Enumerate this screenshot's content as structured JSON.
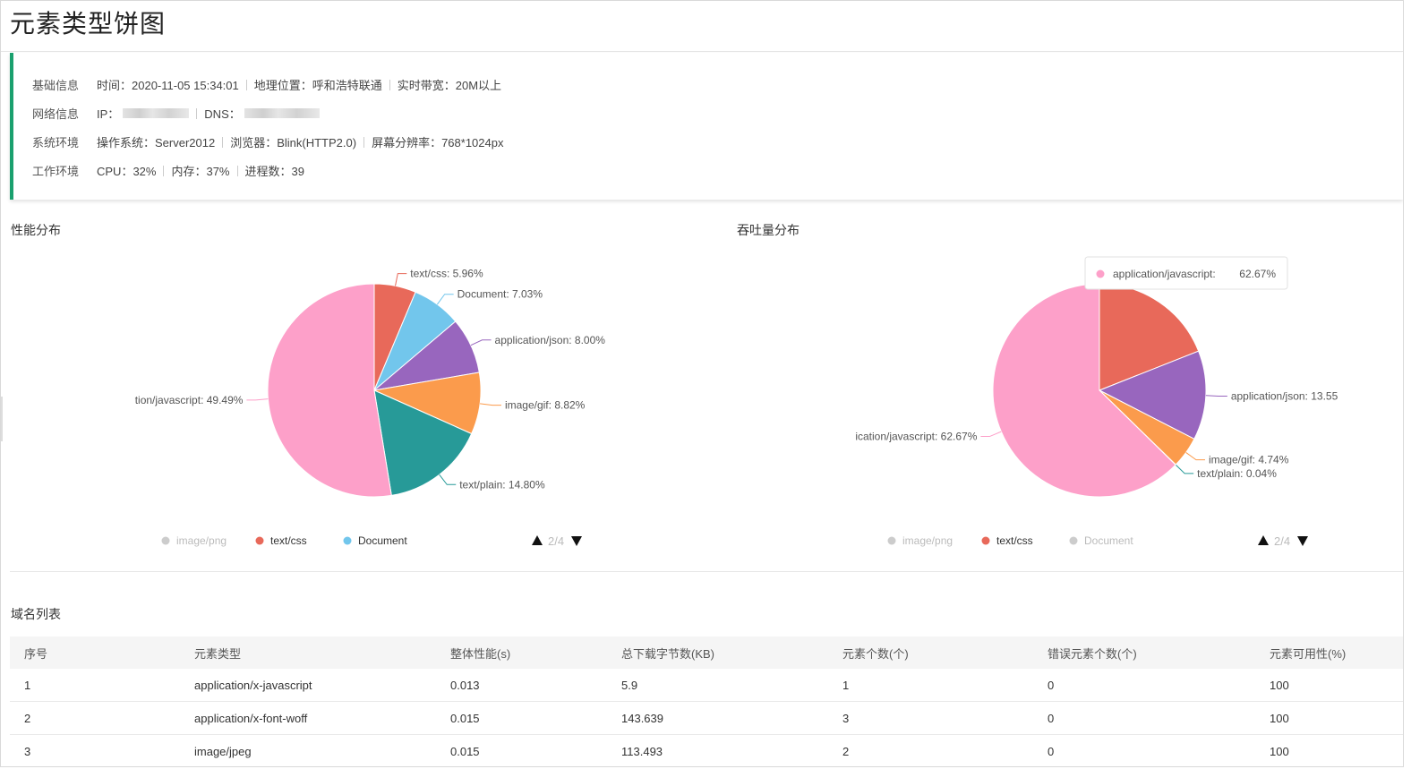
{
  "page": {
    "title": "元素类型饼图"
  },
  "info": {
    "rows": [
      {
        "label": "基础信息",
        "items": [
          "时间：2020-11-05 15:34:01",
          "地理位置：呼和浩特联通",
          "实时带宽：20M以上"
        ]
      },
      {
        "label": "网络信息",
        "ip_label": "IP：",
        "dns_label": "DNS："
      },
      {
        "label": "系统环境",
        "items": [
          "操作系统：Server2012",
          "浏览器：Blink(HTTP2.0)",
          "屏幕分辨率：768*1024px"
        ]
      },
      {
        "label": "工作环境",
        "items": [
          "CPU：32%",
          "内存：37%",
          "进程数：39"
        ]
      }
    ]
  },
  "charts": {
    "left_title": "性能分布",
    "right_title": "吞吐量分布",
    "pager_text": "2/4",
    "tooltip": {
      "name": "application/javascript:",
      "value": "62.67%"
    }
  },
  "chart_data": [
    {
      "type": "pie",
      "title": "性能分布",
      "slices": [
        {
          "name": "text/css",
          "value": 5.96,
          "color": "#e8695a",
          "label": "text/css: 5.96%"
        },
        {
          "name": "Document",
          "value": 7.03,
          "color": "#72c6ec",
          "label": "Document: 7.03%"
        },
        {
          "name": "application/json",
          "value": 8.0,
          "color": "#9866be",
          "label": "application/json: 8.00%"
        },
        {
          "name": "image/gif",
          "value": 8.82,
          "color": "#fb9b4c",
          "label": "image/gif: 8.82%"
        },
        {
          "name": "text/plain",
          "value": 14.8,
          "color": "#279a98",
          "label": "text/plain: 14.80%"
        },
        {
          "name": "application/javascript",
          "value": 49.49,
          "color": "#fda0c9",
          "label": "tion/javascript: 49.49%"
        }
      ],
      "legend": [
        {
          "name": "image/png",
          "color": "#cccccc",
          "active": false
        },
        {
          "name": "text/css",
          "color": "#e8695a",
          "active": true
        },
        {
          "name": "Document",
          "color": "#72c6ec",
          "active": true
        }
      ]
    },
    {
      "type": "pie",
      "title": "吞吐量分布",
      "slices": [
        {
          "name": "text/css",
          "value": 19.0,
          "color": "#e8695a",
          "label": ""
        },
        {
          "name": "application/json",
          "value": 13.55,
          "color": "#9866be",
          "label": "application/json: 13.55"
        },
        {
          "name": "image/gif",
          "value": 4.74,
          "color": "#fb9b4c",
          "label": "image/gif: 4.74%"
        },
        {
          "name": "text/plain",
          "value": 0.04,
          "color": "#279a98",
          "label": "text/plain: 0.04%"
        },
        {
          "name": "application/javascript",
          "value": 62.67,
          "color": "#fda0c9",
          "label": "ication/javascript: 62.67%"
        }
      ],
      "legend": [
        {
          "name": "image/png",
          "color": "#cccccc",
          "active": false
        },
        {
          "name": "text/css",
          "color": "#e8695a",
          "active": true
        },
        {
          "name": "Document",
          "color": "#cccccc",
          "active": false
        }
      ]
    }
  ],
  "table": {
    "title": "域名列表",
    "headers": [
      "序号",
      "元素类型",
      "整体性能(s)",
      "总下载字节数(KB)",
      "元素个数(个)",
      "错误元素个数(个)",
      "元素可用性(%)"
    ],
    "rows": [
      [
        "1",
        "application/x-javascript",
        "0.013",
        "5.9",
        "1",
        "0",
        "100"
      ],
      [
        "2",
        "application/x-font-woff",
        "0.015",
        "143.639",
        "3",
        "0",
        "100"
      ],
      [
        "3",
        "image/jpeg",
        "0.015",
        "113.493",
        "2",
        "0",
        "100"
      ]
    ]
  }
}
